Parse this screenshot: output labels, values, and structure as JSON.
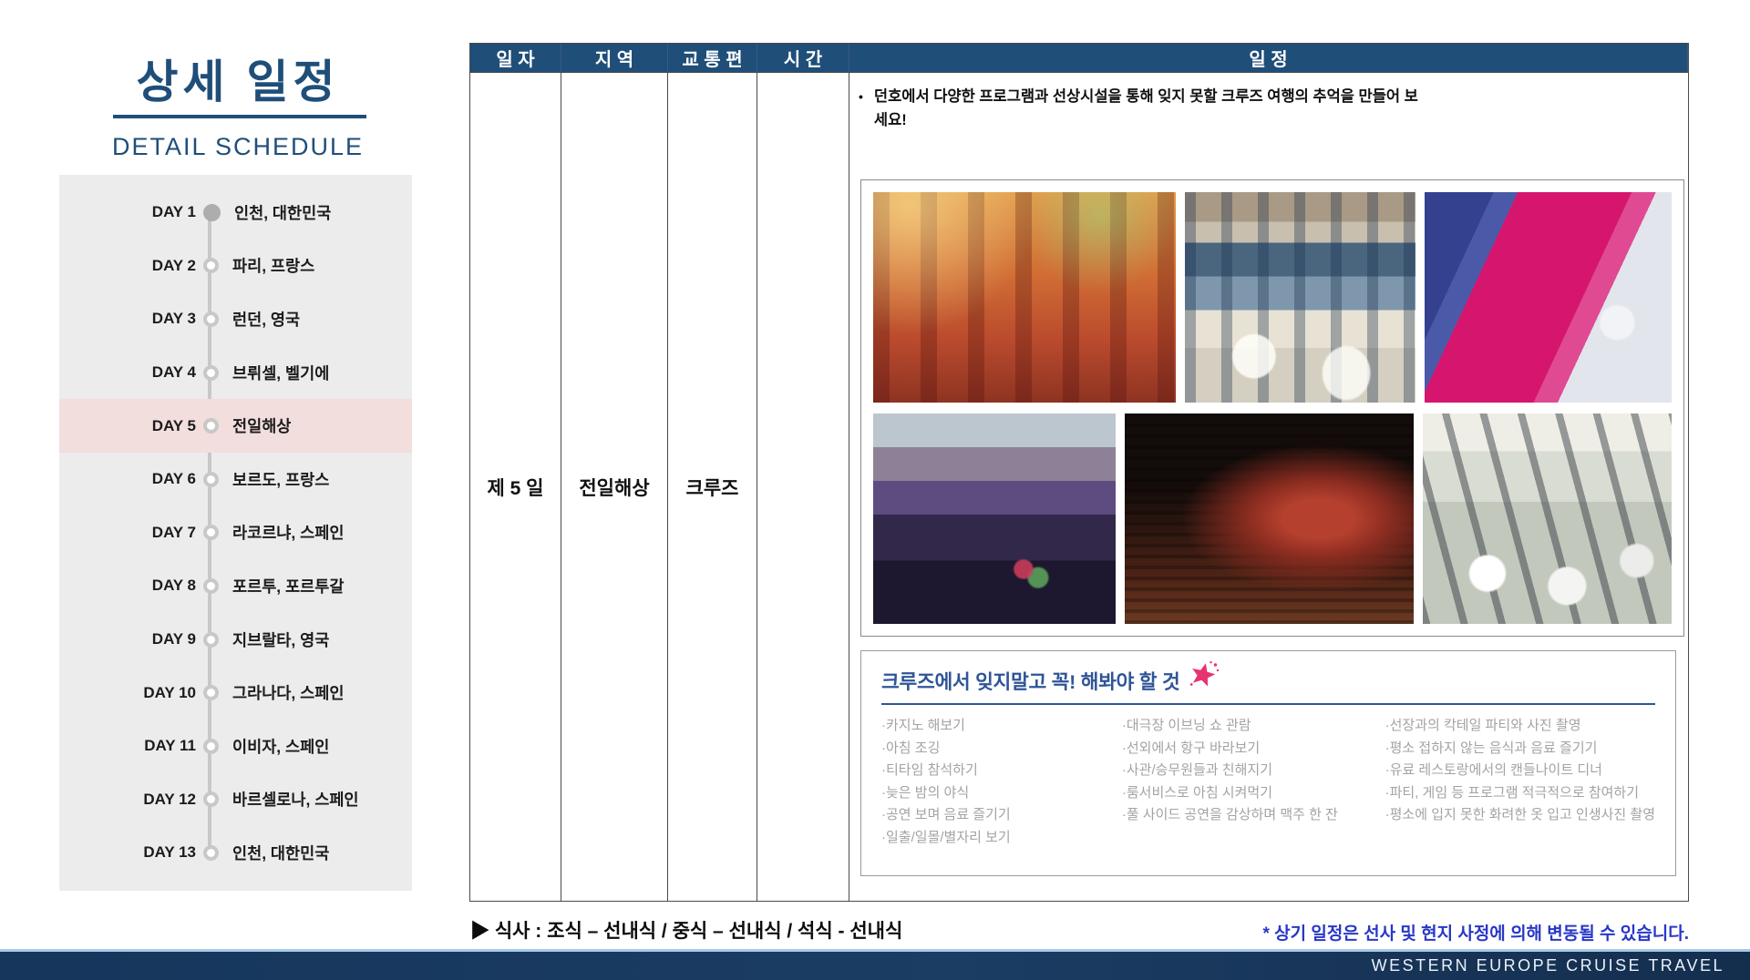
{
  "sidebar": {
    "title": "상세 일정",
    "subtitle": "DETAIL SCHEDULE",
    "days": [
      {
        "day": "DAY 1",
        "location": "인천, 대한민국"
      },
      {
        "day": "DAY 2",
        "location": "파리, 프랑스"
      },
      {
        "day": "DAY 3",
        "location": "런던, 영국"
      },
      {
        "day": "DAY 4",
        "location": "브뤼셀, 벨기에"
      },
      {
        "day": "DAY 5",
        "location": "전일해상"
      },
      {
        "day": "DAY 6",
        "location": "보르도, 프랑스"
      },
      {
        "day": "DAY 7",
        "location": "라코르냐, 스페인"
      },
      {
        "day": "DAY 8",
        "location": "포르투, 포르투갈"
      },
      {
        "day": "DAY 9",
        "location": "지브랄타, 영국"
      },
      {
        "day": "DAY 10",
        "location": "그라나다, 스페인"
      },
      {
        "day": "DAY 11",
        "location": "이비자, 스페인"
      },
      {
        "day": "DAY 12",
        "location": "바르셀로나, 스페인"
      },
      {
        "day": "DAY 13",
        "location": "인천, 대한민국"
      }
    ],
    "active_day_index": 4
  },
  "table": {
    "headers": [
      "일 자",
      "지 역",
      "교 통 편",
      "시 간",
      "일 정"
    ],
    "row": {
      "date": "제 5 일",
      "region": "전일해상",
      "transport": "크루즈",
      "time": ""
    },
    "bullet_marker": "•",
    "bullet": "던호에서 다양한 프로그램과 선상시설을 통해 잊지 못할 크루즈 여행의 추억을 만들어 보세요!",
    "photos": [
      {
        "name": "stage-show-photo"
      },
      {
        "name": "restaurant-photo"
      },
      {
        "name": "water-slide-photo"
      },
      {
        "name": "casino-photo"
      },
      {
        "name": "theater-photo"
      },
      {
        "name": "gym-photo"
      }
    ],
    "mustdo": {
      "title": "크루즈에서 잊지말고 꼭! 해봐야 할 것",
      "star_icon": "star-icon",
      "columns": [
        [
          "·카지노 해보기",
          "·아침 조깅",
          "·티타임 참석하기",
          "·늦은 밤의 야식",
          "·공연 보며 음료 즐기기",
          "·일출/일몰/별자리 보기"
        ],
        [
          "·대극장 이브닝 쇼 관람",
          "·선외에서 항구 바라보기",
          "·사관/승무원들과 친해지기",
          "·룸서비스로 아침 시켜먹기",
          "·풀 사이드 공연을 감상하며 맥주 한 잔"
        ],
        [
          "·선장과의 칵테일 파티와 사진 촬영",
          "·평소 접하지 않는 음식과 음료 즐기기",
          "·유료 레스토랑에서의 캔들나이트 디너",
          "·파티, 게임 등 프로그램 적극적으로 참여하기",
          "·평소에 입지 못한 화려한 옷 입고 인생사진 촬영"
        ]
      ]
    }
  },
  "notes": {
    "meal": "▶ 식사 : 조식 – 선내식 / 중식 – 선내식 / 석식 - 선내식",
    "change": "* 상기 일정은 선사 및 현지 사정에 의해 변동될 수 있습니다."
  },
  "footer": {
    "brand": "WESTERN EUROPE CRUISE TRAVEL"
  },
  "colors": {
    "accent_navy": "#1F4E79",
    "sidebar_gray": "#ECECEC",
    "highlight_pink": "#F2DEDD",
    "timeline_gray": "#C8C8C8",
    "mustdo_blue": "#2F5597",
    "mustdo_text_gray": "#A3A3A3",
    "note_blue": "#2837C8",
    "footer_navy": "#1B3C63",
    "footer_line_blue": "#A9C9E8",
    "star_pink": "#E8336E"
  }
}
